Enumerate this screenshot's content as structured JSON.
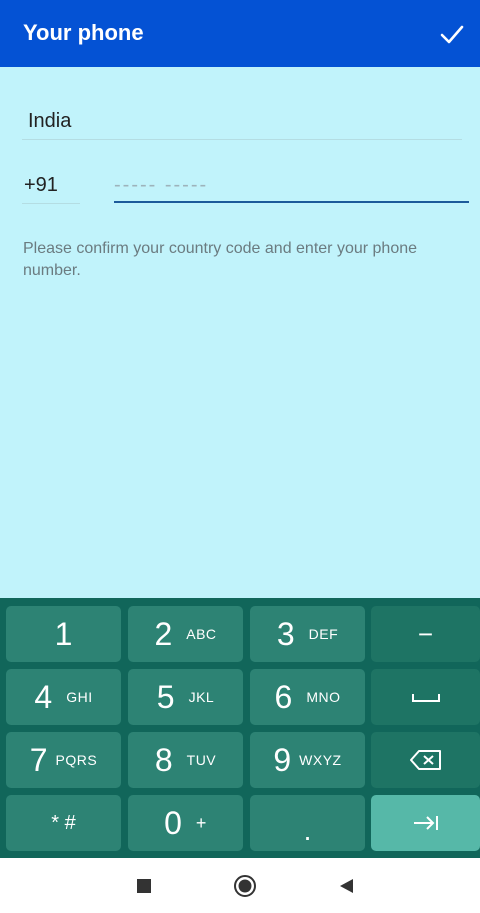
{
  "appbar": {
    "title": "Your phone",
    "confirm_icon": "check-icon"
  },
  "form": {
    "country": "India",
    "country_code": "+91",
    "phone_placeholder": "----- -----",
    "phone_value": "",
    "hint": "Please confirm your country code and enter your phone number."
  },
  "keypad": {
    "keys": [
      {
        "digit": "1",
        "letters": ""
      },
      {
        "digit": "2",
        "letters": "ABC"
      },
      {
        "digit": "3",
        "letters": "DEF"
      },
      {
        "digit": "−",
        "letters": ""
      },
      {
        "digit": "4",
        "letters": "GHI"
      },
      {
        "digit": "5",
        "letters": "JKL"
      },
      {
        "digit": "6",
        "letters": "MNO"
      },
      {
        "digit": "␣",
        "letters": ""
      },
      {
        "digit": "7",
        "letters": "PQRS"
      },
      {
        "digit": "8",
        "letters": "TUV"
      },
      {
        "digit": "9",
        "letters": "WXYZ"
      },
      {
        "digit": "⌫",
        "letters": ""
      },
      {
        "digit": "* #",
        "letters": ""
      },
      {
        "digit": "0",
        "letters": "+"
      },
      {
        "digit": ".",
        "letters": ""
      },
      {
        "digit": "⇥",
        "letters": ""
      }
    ]
  },
  "navbar": {
    "recents_icon": "square-icon",
    "home_icon": "circle-icon",
    "back_icon": "triangle-back-icon"
  },
  "colors": {
    "appbar": "#0452d4",
    "background": "#c1f3fb",
    "keyboard": "#11665a",
    "key": "#2d8374",
    "enter_key": "#56b8a8"
  }
}
